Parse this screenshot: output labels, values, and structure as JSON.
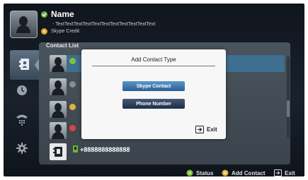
{
  "header": {
    "name": "Name",
    "mood": "- TextTextTextTextTextTextTextTextTextTextText",
    "credit": "Skype Credit"
  },
  "sidebar": {
    "items": [
      {
        "icon": "contacts-icon",
        "active": true
      },
      {
        "icon": "clock-icon",
        "active": false
      },
      {
        "icon": "phone-dialpad-icon",
        "active": false
      },
      {
        "icon": "gear-icon",
        "active": false
      }
    ]
  },
  "contact_list": {
    "title": "Contact List",
    "rows": [
      {
        "status_color": "#7fc241",
        "selected": true
      },
      {
        "status_color": "#8c8c8c",
        "selected": false
      },
      {
        "status_color": "#e1b23a",
        "selected": false
      },
      {
        "status_color": "#e04141",
        "selected": false
      }
    ],
    "phone_entry": "+8888888888888"
  },
  "dialog": {
    "title": "Add Contact Type",
    "skype_button": "Skype Contact",
    "phone_button": "Phone Number",
    "exit_label": "Exit"
  },
  "footer": {
    "status_label": "Status",
    "add_contact_label": "Add Contact",
    "exit_label": "Exit"
  }
}
